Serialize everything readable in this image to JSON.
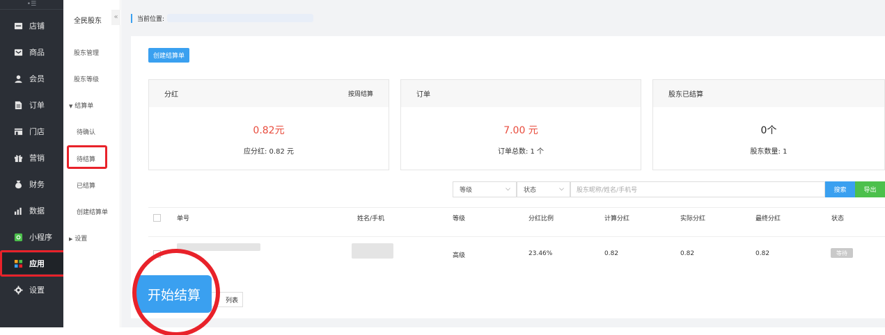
{
  "sidebar": {
    "items": [
      {
        "label": "店铺",
        "icon": "shop-icon"
      },
      {
        "label": "商品",
        "icon": "goods-icon"
      },
      {
        "label": "会员",
        "icon": "member-icon"
      },
      {
        "label": "订单",
        "icon": "order-icon"
      },
      {
        "label": "门店",
        "icon": "store-icon"
      },
      {
        "label": "营销",
        "icon": "gift-icon"
      },
      {
        "label": "财务",
        "icon": "money-bag-icon"
      },
      {
        "label": "数据",
        "icon": "bar-chart-icon"
      },
      {
        "label": "小程序",
        "icon": "mini-program-icon"
      },
      {
        "label": "应用",
        "icon": "apps-icon"
      },
      {
        "label": "设置",
        "icon": "gear-icon"
      }
    ],
    "active": "应用"
  },
  "submenu": {
    "title": "全民股东",
    "items": [
      "股东管理",
      "股东等级"
    ],
    "group_settlement": "结算单",
    "settlement_items": [
      "待确认",
      "待结算",
      "已结算",
      "创建结算单"
    ],
    "group_settings": "设置"
  },
  "breadcrumb": {
    "label": "当前位置:"
  },
  "toolbar": {
    "create_label": "创建结算单"
  },
  "cards": [
    {
      "title": "分红",
      "right": "按周结算",
      "value": "0.82元",
      "sub": "应分红: 0.82 元"
    },
    {
      "title": "订单",
      "right": "",
      "value": "7.00 元",
      "sub": "订单总数: 1 个"
    },
    {
      "title": "股东已结算",
      "right": "",
      "value": "0个",
      "sub": "股东数量: 1"
    }
  ],
  "filters": {
    "level": "等级",
    "status": "状态",
    "search_placeholder": "股东昵称/姓名/手机号",
    "search_label": "搜索",
    "export_label": "导出"
  },
  "table": {
    "headers": [
      "单号",
      "姓名/手机",
      "等级",
      "分红比例",
      "计算分红",
      "实际分红",
      "最终分红",
      "状态"
    ],
    "rows": [
      {
        "level": "高级",
        "ratio": "23.46%",
        "calc": "0.82",
        "actual": "0.82",
        "final": "0.82",
        "status": "等待"
      }
    ]
  },
  "footer": {
    "list_label": "列表"
  },
  "annotation": {
    "start_label": "开始结算"
  },
  "colors": {
    "accent": "#3aa0f0",
    "highlight": "#e8222a",
    "value_red": "#e84b3c",
    "green": "#4cc04c",
    "sidebar": "#2b2f36"
  }
}
